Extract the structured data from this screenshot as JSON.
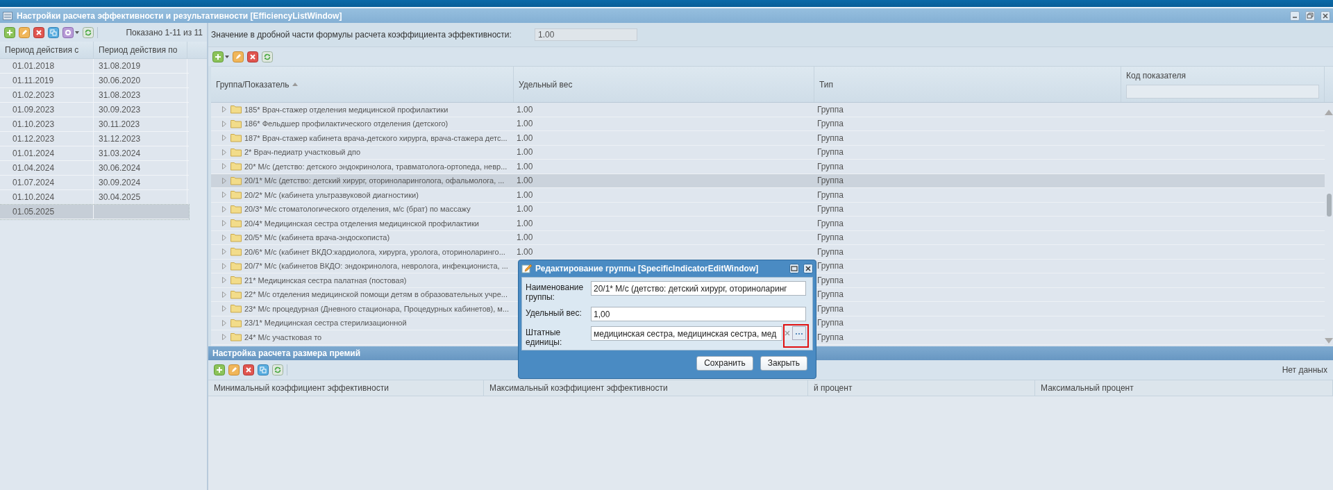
{
  "window": {
    "title": "Настройки расчета эффективности и результативности [EfficiencyListWindow]"
  },
  "periods": {
    "status": "Показано 1-11 из 11",
    "columns": [
      "Период действия с",
      "Период действия по"
    ],
    "rows": [
      {
        "from": "01.01.2018",
        "to": "31.08.2019",
        "selected": false
      },
      {
        "from": "01.11.2019",
        "to": "30.06.2020",
        "selected": false
      },
      {
        "from": "01.02.2023",
        "to": "31.08.2023",
        "selected": false
      },
      {
        "from": "01.09.2023",
        "to": "30.09.2023",
        "selected": false
      },
      {
        "from": "01.10.2023",
        "to": "30.11.2023",
        "selected": false
      },
      {
        "from": "01.12.2023",
        "to": "31.12.2023",
        "selected": false
      },
      {
        "from": "01.01.2024",
        "to": "31.03.2024",
        "selected": false
      },
      {
        "from": "01.04.2024",
        "to": "30.06.2024",
        "selected": false
      },
      {
        "from": "01.07.2024",
        "to": "30.09.2024",
        "selected": false
      },
      {
        "from": "01.10.2024",
        "to": "30.04.2025",
        "selected": false
      },
      {
        "from": "01.05.2025",
        "to": "",
        "selected": true
      }
    ]
  },
  "coefficient": {
    "label": "Значение в дробной части формулы расчета коэффициента эффективности:",
    "value": "1.00"
  },
  "indicators": {
    "columns": [
      {
        "label": "Группа/Показатель",
        "sorted": true
      },
      {
        "label": "Удельный вес",
        "sorted": false
      },
      {
        "label": "Тип",
        "sorted": false
      },
      {
        "label": "Код показателя",
        "sorted": false
      }
    ],
    "rows": [
      {
        "name": "185* Врач-стажер отделения медицинской профилактики",
        "weight": "1.00",
        "type": "Группа",
        "selected": false
      },
      {
        "name": "186* Фельдшер профилактического отделения (детского)",
        "weight": "1.00",
        "type": "Группа",
        "selected": false
      },
      {
        "name": "187* Врач-стажер кабинета врача-детского хирурга, врача-стажера детс...",
        "weight": "1.00",
        "type": "Группа",
        "selected": false
      },
      {
        "name": "2* Врач-педиатр участковый дпо",
        "weight": "1.00",
        "type": "Группа",
        "selected": false
      },
      {
        "name": "20* М/с (детство: детского эндокринолога, травматолога-ортопеда, невр...",
        "weight": "1.00",
        "type": "Группа",
        "selected": false
      },
      {
        "name": "20/1* М/с (детство: детский хирург, оториноларинголога, офальмолога, ...",
        "weight": "1.00",
        "type": "Группа",
        "selected": true
      },
      {
        "name": "20/2* М/с (кабинета ультразвуковой диагностики)",
        "weight": "1.00",
        "type": "Группа",
        "selected": false
      },
      {
        "name": "20/3* М/с стоматологического отделения, м/с (брат) по массажу",
        "weight": "1.00",
        "type": "Группа",
        "selected": false
      },
      {
        "name": "20/4* Медицинская сестра отделения медицинской профилактики",
        "weight": "1.00",
        "type": "Группа",
        "selected": false
      },
      {
        "name": "20/5* М/с (кабинета врача-эндоскописта)",
        "weight": "1.00",
        "type": "Группа",
        "selected": false
      },
      {
        "name": "20/6* М/с (кабинет ВКДО:кардиолога, хирурга, уролога, оториноларинго...",
        "weight": "1.00",
        "type": "Группа",
        "selected": false
      },
      {
        "name": "20/7* М/с (кабинетов ВКДО: эндокринолога, невролога, инфекциониста, ...",
        "type": "Группа",
        "selected": false
      },
      {
        "name": "21* Медицинская сестра палатная (постовая)",
        "type": "Группа",
        "selected": false
      },
      {
        "name": "22* М/с отделения медицинской помощи детям в образовательных учре...",
        "type": "Группа",
        "selected": false
      },
      {
        "name": "23* М/с процедурная (Дневного стационара, Процедурных кабинетов), м...",
        "type": "Группа",
        "selected": false
      },
      {
        "name": "23/1* Медицинская сестра стерилизационной",
        "type": "Группа",
        "selected": false
      },
      {
        "name": "24* М/с участковая то",
        "type": "Группа",
        "selected": false
      }
    ]
  },
  "bonus": {
    "title": "Настройка расчета размера премий",
    "status": "Нет данных",
    "columns": [
      "Минимальный коэффициент эффективности",
      "Максимальный коэффициент эффективности",
      "й процент",
      "Максимальный процент"
    ]
  },
  "dialog": {
    "title": "Редактирование группы [SpecificIndicatorEditWindow]",
    "fields": [
      {
        "kind": "text",
        "label": "Наименование группы:",
        "value": "20/1* М/с (детство: детский хирург, оториноларинг"
      },
      {
        "kind": "text",
        "label": "Удельный вес:",
        "value": "1,00"
      },
      {
        "kind": "picker",
        "label": "Штатные единицы:",
        "value": "медицинская сестра, медицинская сестра, мед",
        "highlighted": true
      }
    ],
    "buttons": [
      "Сохранить",
      "Закрыть"
    ]
  }
}
